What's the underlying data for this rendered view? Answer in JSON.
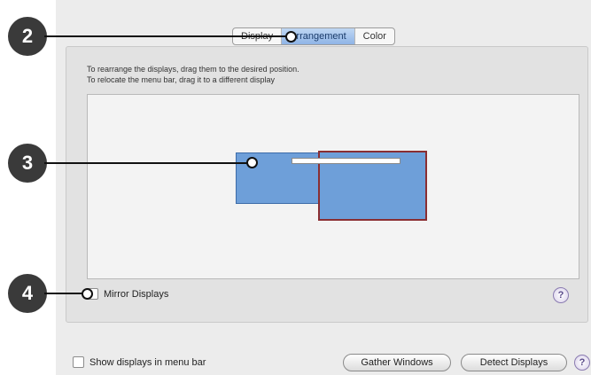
{
  "tabs": {
    "display_label": "Display",
    "arrangement_label": "Arrangement",
    "color_label": "Color"
  },
  "instructions": {
    "line1": "To rearrange the displays, drag them to the desired position.",
    "line2": "To relocate the menu bar, drag it to a different display"
  },
  "options": {
    "mirror_label": "Mirror Displays",
    "show_in_menu_label": "Show displays in menu bar"
  },
  "buttons": {
    "gather": "Gather Windows",
    "detect": "Detect Displays",
    "help": "?"
  },
  "callouts": [
    "2",
    "3",
    "4"
  ],
  "colors": {
    "display_fill": "#6e9fd9",
    "primary_border": "#8a2e32",
    "callout_bg": "#3a3a3a"
  }
}
